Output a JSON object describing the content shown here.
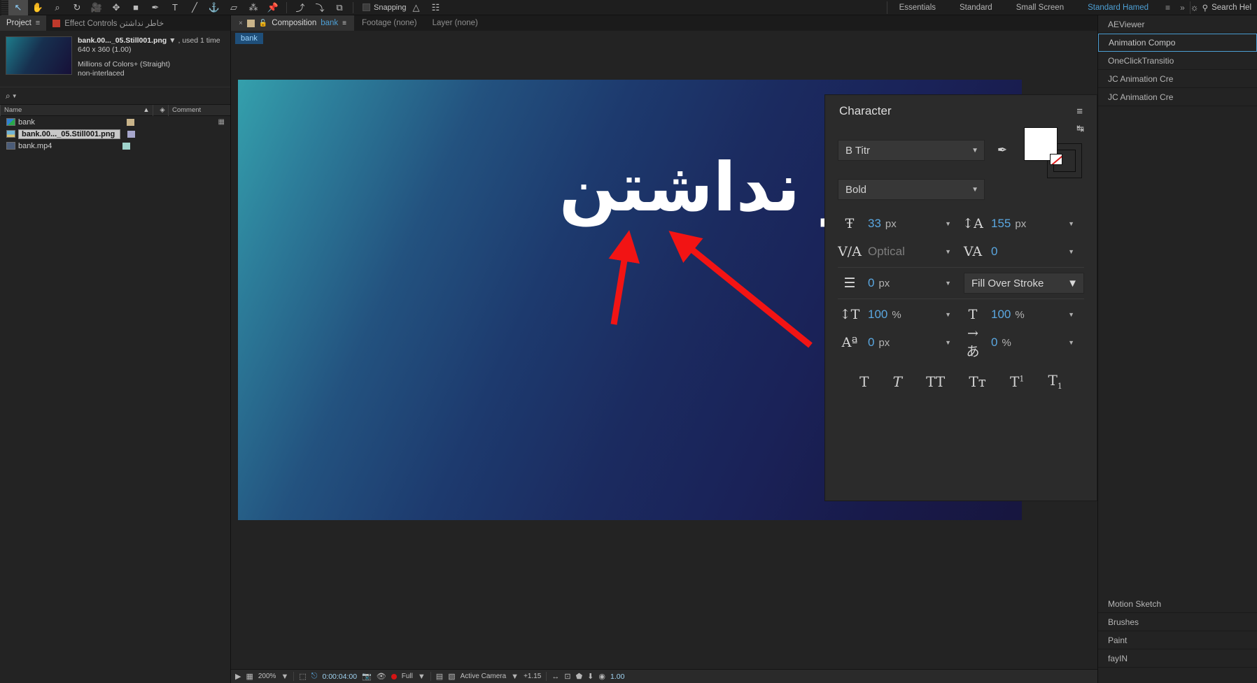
{
  "toolbar": {
    "tools": [
      {
        "name": "selection-tool",
        "glyph": "↖",
        "selected": true
      },
      {
        "name": "hand-tool",
        "glyph": "✋",
        "selected": false
      },
      {
        "name": "zoom-tool",
        "glyph": "⌕",
        "selected": false
      },
      {
        "name": "rotation-tool",
        "glyph": "↻",
        "selected": false
      },
      {
        "name": "camera-tool",
        "glyph": "🎥",
        "selected": false
      },
      {
        "name": "pan-behind-tool",
        "glyph": "✥",
        "selected": false
      },
      {
        "name": "shape-tool",
        "glyph": "■",
        "selected": false
      },
      {
        "name": "pen-tool",
        "glyph": "✒",
        "selected": false
      },
      {
        "name": "type-tool",
        "glyph": "T",
        "selected": false
      },
      {
        "name": "brush-tool",
        "glyph": "╱",
        "selected": false
      },
      {
        "name": "clone-stamp-tool",
        "glyph": "⚓",
        "selected": false
      },
      {
        "name": "eraser-tool",
        "glyph": "▱",
        "selected": false
      },
      {
        "name": "roto-brush-tool",
        "glyph": "⁂",
        "selected": false
      },
      {
        "name": "puppet-pin-tool",
        "glyph": "📌",
        "selected": false
      }
    ],
    "tools_right": [
      {
        "name": "anchor-tool",
        "glyph": "⤴"
      },
      {
        "name": "unified-camera-tool",
        "glyph": "⤵"
      },
      {
        "name": "align-tool",
        "glyph": "⧉"
      }
    ],
    "snapping_label": "Snapping",
    "workspaces": [
      "Essentials",
      "Standard",
      "Small Screen"
    ],
    "workspace_active": "Standard Hamed",
    "workspace_menu_glyph": "≡",
    "workspace_more_glyph": "»",
    "search_label": "Search Hel"
  },
  "project": {
    "tabs": [
      {
        "label": "Project",
        "active": true,
        "menu": "≡"
      },
      {
        "label": "Effect Controls خاطر نداشتن",
        "active": false
      }
    ],
    "selected_item": {
      "filename": "bank.00..._05.Still001.png",
      "caret": "▼",
      "used": ", used 1 time",
      "dimensions": "640 x 360 (1.00)",
      "color_depth": "Millions of Colors+ (Straight)",
      "interlace": "non-interlaced"
    },
    "search_placeholder": "",
    "search_icon": "⌕",
    "columns": [
      "Name",
      "Comment"
    ],
    "sort_caret": "▲",
    "tag_icon": "🏷",
    "items": [
      {
        "name": "bank",
        "type": "comp",
        "label_color": "#c9b48a",
        "selected": false
      },
      {
        "name": "bank.00..._05.Still001.png",
        "type": "png",
        "label_color": "#a6a6cc",
        "selected": true
      },
      {
        "name": "bank.mp4",
        "type": "mp4",
        "label_color": "#9fd3cc",
        "selected": false
      }
    ]
  },
  "composition": {
    "tabs": [
      {
        "close": "×",
        "label": "Composition",
        "name": "bank",
        "menu": "≡",
        "active": true
      },
      {
        "label": "Footage (none)",
        "active": false
      },
      {
        "label": "Layer (none)",
        "active": false
      }
    ],
    "breadcrumb": "bank",
    "stage_text": "خاطر نداشتن"
  },
  "character": {
    "title": "Character",
    "menu_glyph": "≡",
    "font_family": "B Titr",
    "font_style": "Bold",
    "caret": "▼",
    "eyedropper_icon": "✒",
    "swap_icon": "↹",
    "font_size": {
      "icon": "Ŧ",
      "value": "33",
      "unit": "px"
    },
    "leading": {
      "icon": "↕A",
      "value": "155",
      "unit": "px"
    },
    "kerning": {
      "icon": "V/A",
      "value": "Optical",
      "unit": ""
    },
    "tracking": {
      "icon": "VA",
      "value": "0",
      "unit": ""
    },
    "stroke_width": {
      "icon": "☰",
      "value": "0",
      "unit": "px"
    },
    "fill_stroke_order": "Fill Over Stroke",
    "vertical_scale": {
      "icon": "↕T",
      "value": "100",
      "unit": "%"
    },
    "horizontal_scale": {
      "icon": "T",
      "value": "100",
      "unit": "%"
    },
    "baseline_shift": {
      "icon": "Aª",
      "value": "0",
      "unit": "px"
    },
    "tsume": {
      "icon": "→あ",
      "value": "0",
      "unit": "%"
    },
    "style_buttons": [
      {
        "name": "faux-bold-button",
        "glyph": "T"
      },
      {
        "name": "faux-italic-button",
        "glyph": "T"
      },
      {
        "name": "all-caps-button",
        "glyph": "TT"
      },
      {
        "name": "small-caps-button",
        "glyph": "Tᴛ"
      },
      {
        "name": "superscript-button",
        "glyph": "T"
      },
      {
        "name": "subscript-button",
        "glyph": "T"
      }
    ]
  },
  "right_dock": {
    "items": [
      {
        "label": "AEViewer",
        "active": false
      },
      {
        "label": "Animation Compo",
        "active": true
      },
      {
        "label": "OneClickTransitio",
        "active": false
      },
      {
        "label": "JC Animation Cre",
        "active": false
      },
      {
        "label": "JC Animation Cre",
        "active": false
      }
    ],
    "bottom_items": [
      {
        "label": "Motion Sketch"
      },
      {
        "label": "Brushes"
      },
      {
        "label": "Paint"
      },
      {
        "label": "fayIN"
      }
    ]
  },
  "bottom_bar": {
    "zoom": "200%",
    "timecode": "0:00:04:00",
    "resolution": "Full",
    "quality_label": "Active Camera",
    "exposure": "+1.15",
    "fps": "1.00",
    "icons": {
      "render": "▶",
      "grid": "▦",
      "caret": "▼",
      "region": "⬚",
      "mask": "⎋",
      "snapshot": "📷",
      "show": "👁",
      "record": "●",
      "view": "▤",
      "channel": "▧",
      "timer": "⌚",
      "fast": "⚡",
      "ruler": "↔",
      "guide": "⊡",
      "threed": "⬟",
      "exp": "⬇",
      "gear": "◉"
    }
  }
}
